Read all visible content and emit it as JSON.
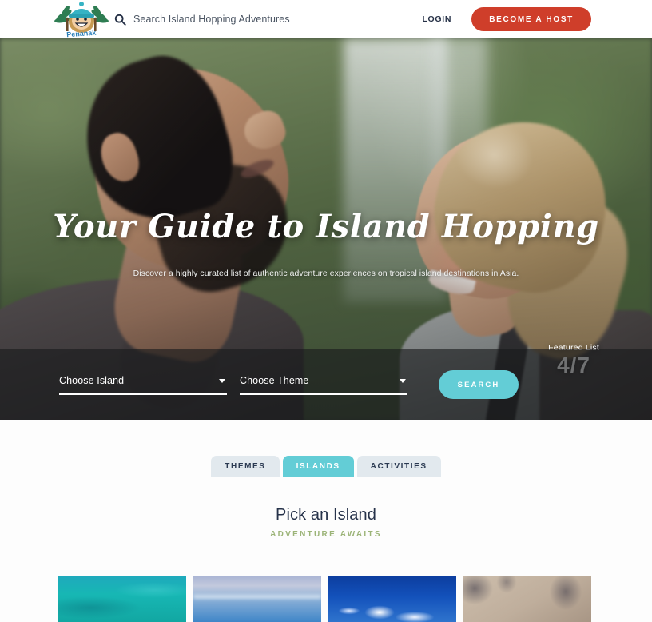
{
  "header": {
    "logo_alt": "Penanak island hopping logo",
    "search": {
      "icon": "search-icon",
      "placeholder": "Search Island Hopping Adventures"
    },
    "login_label": "LOGIN",
    "host_button_label": "BECOME A HOST"
  },
  "hero": {
    "title": "Your Guide to Island Hopping",
    "subtitle": "Discover a highly curated list of authentic adventure experiences on tropical island destinations in Asia.",
    "featured": {
      "label": "Featured List",
      "count": "4/7"
    },
    "search_bar": {
      "island_select": {
        "value": "Choose Island",
        "caret": "chevron-down-icon"
      },
      "theme_select": {
        "value": "Choose Theme",
        "caret": "chevron-down-icon"
      },
      "search_button_label": "SEARCH"
    }
  },
  "browse": {
    "tabs": [
      {
        "label": "THEMES",
        "active": false
      },
      {
        "label": "ISLANDS",
        "active": true
      },
      {
        "label": "ACTIVITIES",
        "active": false
      }
    ],
    "title": "Pick an Island",
    "subtitle": "ADVENTURE AWAITS",
    "cards": [
      {
        "name": "turquoise-lagoon"
      },
      {
        "name": "pale-blue-horizon"
      },
      {
        "name": "deep-blue-sky-clouds"
      },
      {
        "name": "palm-shadow-sand"
      }
    ]
  },
  "colors": {
    "accent_teal": "#63cdd6",
    "brand_red": "#cf3e2a",
    "heading_navy": "#26324a",
    "sub_green": "#9cb478",
    "tab_inactive": "#e2e9ee"
  }
}
